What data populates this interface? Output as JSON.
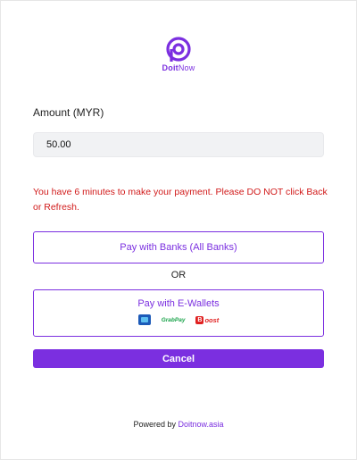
{
  "brand": {
    "name_part1": "Doit",
    "name_part2": "Now",
    "logo_icon": "doitnow-logo-icon",
    "accent_color": "#7b2fe0"
  },
  "form": {
    "amount_label": "Amount (MYR)",
    "amount_value": "50.00",
    "warning": "You have 6 minutes to make your payment. Please DO NOT click Back or Refresh.",
    "warning_color": "#d11a1a"
  },
  "actions": {
    "banks_label": "Pay with Banks (All Banks)",
    "or_label": "OR",
    "ewallets_label": "Pay with E-Wallets",
    "wallets": {
      "tng_icon": "touch-n-go-icon",
      "grabpay_label": "GrabPay",
      "boost_letter": "B",
      "boost_label": "oost"
    },
    "cancel_label": "Cancel"
  },
  "footer": {
    "powered_text": "Powered by",
    "powered_link": "Doitnow.asia"
  }
}
